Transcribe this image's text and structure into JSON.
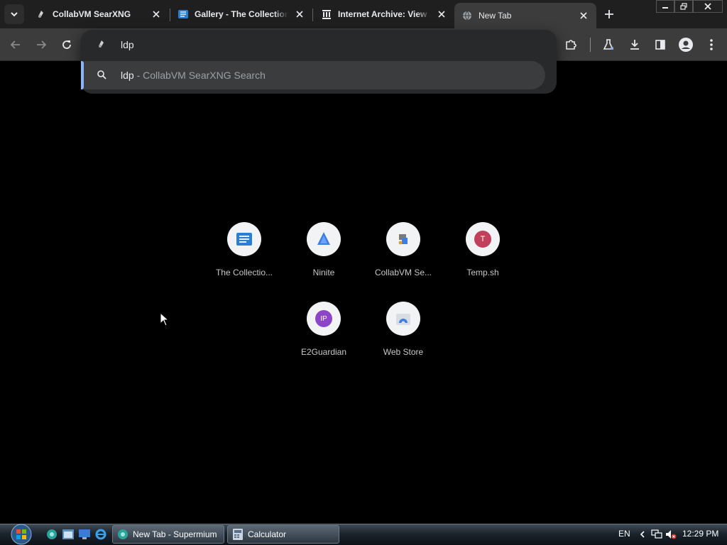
{
  "tabs": [
    {
      "title": "CollabVM SearXNG",
      "favicon": "searxng-icon",
      "active": false
    },
    {
      "title": "Gallery - The Collection",
      "favicon": "book-icon",
      "active": false
    },
    {
      "title": "Internet Archive: View Archive",
      "favicon": "archive-icon",
      "active": false
    },
    {
      "title": "New Tab",
      "favicon": "globe-icon",
      "active": true
    }
  ],
  "omnibox": {
    "typed_text": "ldp",
    "suggestion": {
      "query": "ldp",
      "separator": " - ",
      "engine": "CollabVM SearXNG Search"
    }
  },
  "shortcuts": [
    {
      "label": "The Collectio...",
      "icon": "book-icon"
    },
    {
      "label": "Ninite",
      "icon": "ninite-icon"
    },
    {
      "label": "CollabVM Se...",
      "icon": "searxng-icon"
    },
    {
      "label": "Temp.sh",
      "icon": "letter-T-icon",
      "letter": "T"
    },
    {
      "label": "E2Guardian",
      "icon": "letter-IP-icon",
      "letter": "IP"
    },
    {
      "label": "Web Store",
      "icon": "webstore-icon"
    }
  ],
  "taskbar": {
    "tasks": [
      {
        "label": "New Tab - Supermium",
        "icon": "browser-icon"
      },
      {
        "label": "Calculator",
        "icon": "calculator-icon"
      }
    ],
    "language": "EN",
    "clock": "12:29 PM"
  },
  "colors": {
    "accent": "#8ab4f8",
    "tab_active_bg": "#3c3c3c",
    "tab_strip_bg": "#1f1f1f",
    "ntp_bg": "#000000",
    "temp_sh_circle": "#c2405c",
    "e2guardian_circle": "#8e44c9"
  }
}
